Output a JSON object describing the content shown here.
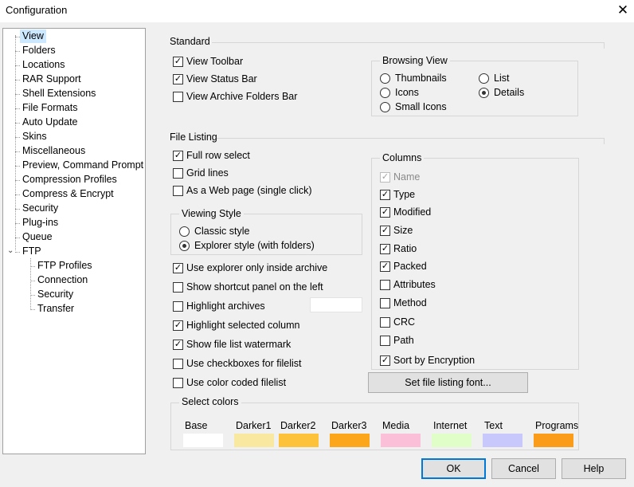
{
  "window": {
    "title": "Configuration",
    "close_glyph": "✕"
  },
  "tree": {
    "items": [
      {
        "label": "View",
        "selected": true
      },
      {
        "label": "Folders"
      },
      {
        "label": "Locations"
      },
      {
        "label": "RAR Support"
      },
      {
        "label": "Shell Extensions"
      },
      {
        "label": "File Formats"
      },
      {
        "label": "Auto Update"
      },
      {
        "label": "Skins"
      },
      {
        "label": "Miscellaneous"
      },
      {
        "label": "Preview, Command Prompt"
      },
      {
        "label": "Compression Profiles"
      },
      {
        "label": "Compress & Encrypt"
      },
      {
        "label": "Security"
      },
      {
        "label": "Plug-ins"
      },
      {
        "label": "Queue"
      },
      {
        "label": "FTP",
        "expanded": true
      }
    ],
    "ftp_children": [
      {
        "label": "FTP Profiles"
      },
      {
        "label": "Connection"
      },
      {
        "label": "Security"
      },
      {
        "label": "Transfer"
      }
    ]
  },
  "standard": {
    "heading": "Standard",
    "view_toolbar": {
      "label": "View Toolbar",
      "checked": true
    },
    "view_status_bar": {
      "label": "View Status Bar",
      "checked": true
    },
    "view_archive_folders_bar": {
      "label": "View Archive Folders Bar",
      "checked": false
    }
  },
  "browsing_view": {
    "heading": "Browsing View",
    "thumbnails": "Thumbnails",
    "icons": "Icons",
    "small_icons": "Small Icons",
    "list": "List",
    "details": "Details",
    "selected": "Details"
  },
  "file_listing": {
    "heading": "File Listing",
    "full_row_select": {
      "label": "Full row select",
      "checked": true
    },
    "grid_lines": {
      "label": "Grid lines",
      "checked": false
    },
    "web_page": {
      "label": "As a Web page (single click)",
      "checked": false
    },
    "use_explorer_only": {
      "label": "Use explorer only inside archive",
      "checked": true
    },
    "show_shortcut_panel": {
      "label": "Show shortcut panel on the left",
      "checked": false
    },
    "highlight_archives": {
      "label": "Highlight archives",
      "checked": false
    },
    "highlight_selected_column": {
      "label": "Highlight selected column",
      "checked": true
    },
    "show_watermark": {
      "label": "Show file list watermark",
      "checked": true
    },
    "use_checkboxes": {
      "label": "Use checkboxes for filelist",
      "checked": false
    },
    "color_coded": {
      "label": "Use color coded filelist",
      "checked": false
    }
  },
  "viewing_style": {
    "heading": "Viewing Style",
    "classic": "Classic style",
    "explorer": "Explorer style (with folders)",
    "selected": "Explorer style (with folders)"
  },
  "columns": {
    "heading": "Columns",
    "items": [
      {
        "label": "Name",
        "checked": true,
        "disabled": true
      },
      {
        "label": "Type",
        "checked": true
      },
      {
        "label": "Modified",
        "checked": true
      },
      {
        "label": "Size",
        "checked": true
      },
      {
        "label": "Ratio",
        "checked": true
      },
      {
        "label": "Packed",
        "checked": true
      },
      {
        "label": "Attributes",
        "checked": false
      },
      {
        "label": "Method",
        "checked": false
      },
      {
        "label": "CRC",
        "checked": false
      },
      {
        "label": "Path",
        "checked": false
      },
      {
        "label": "Sort by Encryption",
        "checked": true
      }
    ]
  },
  "font_button": "Set file listing font...",
  "select_colors": {
    "heading": "Select colors",
    "swatches": [
      {
        "label": "Base",
        "color": "#ffffff"
      },
      {
        "label": "Darker1",
        "color": "#f9e89f"
      },
      {
        "label": "Darker2",
        "color": "#fdc23a"
      },
      {
        "label": "Darker3",
        "color": "#fca61b"
      },
      {
        "label": "Media",
        "color": "#fbbfd8"
      },
      {
        "label": "Internet",
        "color": "#dffec8"
      },
      {
        "label": "Text",
        "color": "#c8c8fd"
      },
      {
        "label": "Programs",
        "color": "#fb9d1a"
      }
    ]
  },
  "buttons": {
    "ok": "OK",
    "cancel": "Cancel",
    "help": "Help"
  },
  "check_glyph": "✓"
}
